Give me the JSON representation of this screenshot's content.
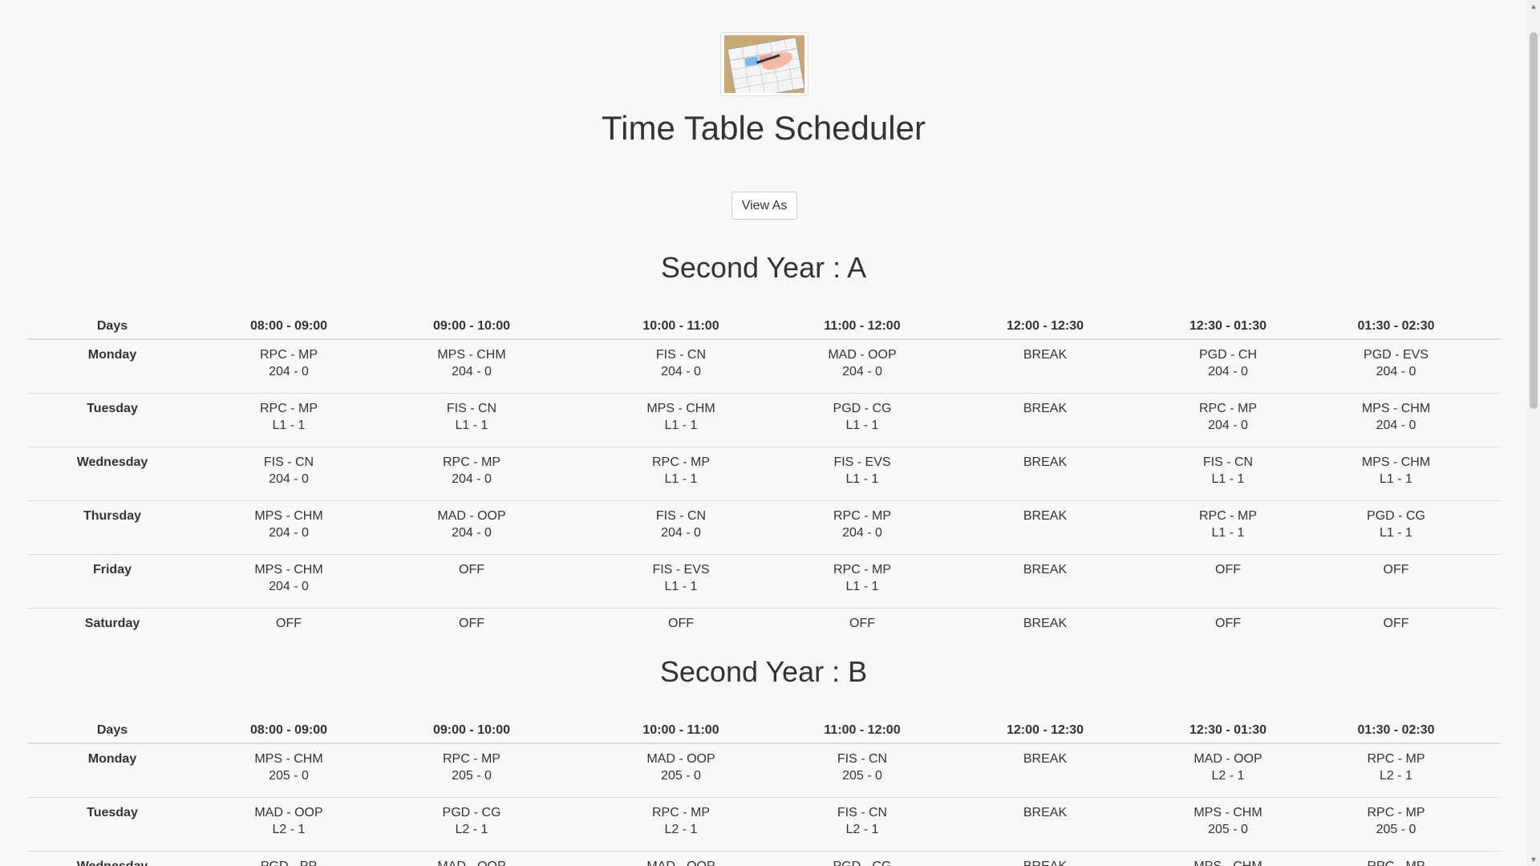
{
  "header": {
    "logo_icon": "timetable-calendar-logo",
    "title": "Time Table Scheduler",
    "view_as_label": "View As"
  },
  "schedules": [
    {
      "title": "Second Year : A",
      "columns": [
        "Days",
        "08:00 - 09:00",
        "09:00 - 10:00",
        "10:00 - 11:00",
        "11:00 - 12:00",
        "12:00 - 12:30",
        "12:30 - 01:30",
        "01:30 - 02:30"
      ],
      "rows": [
        {
          "day": "Monday",
          "cells": [
            [
              "RPC - MP",
              "204 - 0"
            ],
            [
              "MPS - CHM",
              "204 - 0"
            ],
            [
              "FIS - CN",
              "204 - 0"
            ],
            [
              "MAD - OOP",
              "204 - 0"
            ],
            [
              "BREAK"
            ],
            [
              "PGD - CH",
              "204 - 0"
            ],
            [
              "PGD - EVS",
              "204 - 0"
            ]
          ]
        },
        {
          "day": "Tuesday",
          "cells": [
            [
              "RPC - MP",
              "L1 - 1"
            ],
            [
              "FIS - CN",
              "L1 - 1"
            ],
            [
              "MPS - CHM",
              "L1 - 1"
            ],
            [
              "PGD - CG",
              "L1 - 1"
            ],
            [
              "BREAK"
            ],
            [
              "RPC - MP",
              "204 - 0"
            ],
            [
              "MPS - CHM",
              "204 - 0"
            ]
          ]
        },
        {
          "day": "Wednesday",
          "cells": [
            [
              "FIS - CN",
              "204 - 0"
            ],
            [
              "RPC - MP",
              "204 - 0"
            ],
            [
              "RPC - MP",
              "L1 - 1"
            ],
            [
              "FIS - EVS",
              "L1 - 1"
            ],
            [
              "BREAK"
            ],
            [
              "FIS - CN",
              "L1 - 1"
            ],
            [
              "MPS - CHM",
              "L1 - 1"
            ]
          ]
        },
        {
          "day": "Thursday",
          "cells": [
            [
              "MPS - CHM",
              "204 - 0"
            ],
            [
              "MAD - OOP",
              "204 - 0"
            ],
            [
              "FIS - CN",
              "204 - 0"
            ],
            [
              "RPC - MP",
              "204 - 0"
            ],
            [
              "BREAK"
            ],
            [
              "RPC - MP",
              "L1 - 1"
            ],
            [
              "PGD - CG",
              "L1 - 1"
            ]
          ]
        },
        {
          "day": "Friday",
          "cells": [
            [
              "MPS - CHM",
              "204 - 0"
            ],
            [
              "OFF"
            ],
            [
              "FIS - EVS",
              "L1 - 1"
            ],
            [
              "RPC - MP",
              "L1 - 1"
            ],
            [
              "BREAK"
            ],
            [
              "OFF"
            ],
            [
              "OFF"
            ]
          ]
        },
        {
          "day": "Saturday",
          "cells": [
            [
              "OFF"
            ],
            [
              "OFF"
            ],
            [
              "OFF"
            ],
            [
              "OFF"
            ],
            [
              "BREAK"
            ],
            [
              "OFF"
            ],
            [
              "OFF"
            ]
          ]
        }
      ]
    },
    {
      "title": "Second Year : B",
      "columns": [
        "Days",
        "08:00 - 09:00",
        "09:00 - 10:00",
        "10:00 - 11:00",
        "11:00 - 12:00",
        "12:00 - 12:30",
        "12:30 - 01:30",
        "01:30 - 02:30"
      ],
      "rows": [
        {
          "day": "Monday",
          "cells": [
            [
              "MPS - CHM",
              "205 - 0"
            ],
            [
              "RPC - MP",
              "205 - 0"
            ],
            [
              "MAD - OOP",
              "205 - 0"
            ],
            [
              "FIS - CN",
              "205 - 0"
            ],
            [
              "BREAK"
            ],
            [
              "MAD - OOP",
              "L2 - 1"
            ],
            [
              "RPC - MP",
              "L2 - 1"
            ]
          ]
        },
        {
          "day": "Tuesday",
          "cells": [
            [
              "MAD - OOP",
              "L2 - 1"
            ],
            [
              "PGD - CG",
              "L2 - 1"
            ],
            [
              "RPC - MP",
              "L2 - 1"
            ],
            [
              "FIS - CN",
              "L2 - 1"
            ],
            [
              "BREAK"
            ],
            [
              "MPS - CHM",
              "205 - 0"
            ],
            [
              "RPC - MP",
              "205 - 0"
            ]
          ]
        },
        {
          "day": "Wednesday",
          "cells": [
            [
              "PGD - PP"
            ],
            [
              "MAD - OOP"
            ],
            [
              "MAD - OOP"
            ],
            [
              "PGD - CG"
            ],
            [
              "BREAK"
            ],
            [
              "MPS - CHM"
            ],
            [
              "RPC - MP"
            ]
          ]
        }
      ]
    }
  ],
  "scrollbar": {
    "up_icon": "scroll-up-arrow-icon",
    "down_icon": "scroll-down-arrow-icon"
  }
}
